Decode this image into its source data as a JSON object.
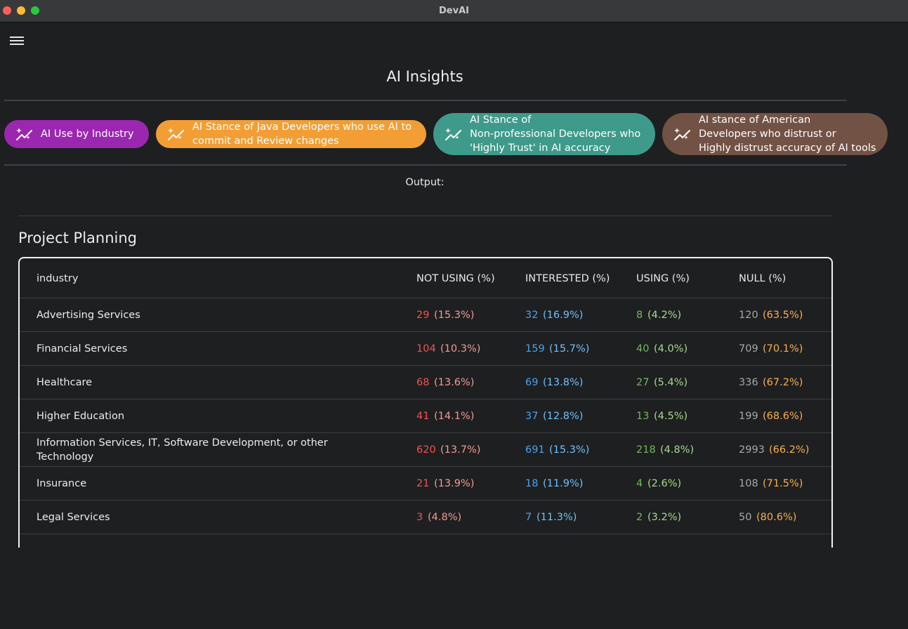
{
  "window": {
    "title": "DevAI"
  },
  "page": {
    "title": "AI Insights",
    "output_label": "Output:"
  },
  "chips": [
    {
      "label": "AI Use by Industry",
      "color": "#9b27b0",
      "icon": "sparkle-chart-icon"
    },
    {
      "label": "AI Stance of Java Developers who use AI to\n commit and Review changes",
      "color": "#f39e34",
      "icon": "sparkle-chart-icon"
    },
    {
      "label": "AI Stance of\nNon-professional Developers who\n'Highly Trust' in AI accuracy",
      "color": "#3e9a8a",
      "icon": "sparkle-chart-icon"
    },
    {
      "label": "AI stance of American\n Developers who distrust or\nHighly distrust accuracy of AI tools",
      "color": "#725245",
      "icon": "sparkle-chart-icon"
    }
  ],
  "section": {
    "title": "Project Planning"
  },
  "table": {
    "columns": [
      "industry",
      "NOT USING (%)",
      "INTERESTED (%)",
      "USING (%)",
      "NULL (%)"
    ],
    "rows": [
      {
        "industry": "Advertising Services",
        "not_using": "29",
        "not_using_pct": "(15.3%)",
        "interested": "32",
        "interested_pct": "(16.9%)",
        "using": "8",
        "using_pct": "(4.2%)",
        "null": "120",
        "null_pct": "(63.5%)"
      },
      {
        "industry": "Financial Services",
        "not_using": "104",
        "not_using_pct": "(10.3%)",
        "interested": "159",
        "interested_pct": "(15.7%)",
        "using": "40",
        "using_pct": "(4.0%)",
        "null": "709",
        "null_pct": "(70.1%)"
      },
      {
        "industry": "Healthcare",
        "not_using": "68",
        "not_using_pct": "(13.6%)",
        "interested": "69",
        "interested_pct": "(13.8%)",
        "using": "27",
        "using_pct": "(5.4%)",
        "null": "336",
        "null_pct": "(67.2%)"
      },
      {
        "industry": "Higher Education",
        "not_using": "41",
        "not_using_pct": "(14.1%)",
        "interested": "37",
        "interested_pct": "(12.8%)",
        "using": "13",
        "using_pct": "(4.5%)",
        "null": "199",
        "null_pct": "(68.6%)"
      },
      {
        "industry": "Information Services, IT, Software Development, or other\nTechnology",
        "not_using": "620",
        "not_using_pct": "(13.7%)",
        "interested": "691",
        "interested_pct": "(15.3%)",
        "using": "218",
        "using_pct": "(4.8%)",
        "null": "2993",
        "null_pct": "(66.2%)"
      },
      {
        "industry": "Insurance",
        "not_using": "21",
        "not_using_pct": "(13.9%)",
        "interested": "18",
        "interested_pct": "(11.9%)",
        "using": "4",
        "using_pct": "(2.6%)",
        "null": "108",
        "null_pct": "(71.5%)"
      },
      {
        "industry": "Legal Services",
        "not_using": "3",
        "not_using_pct": "(4.8%)",
        "interested": "7",
        "interested_pct": "(11.3%)",
        "using": "2",
        "using_pct": "(3.2%)",
        "null": "50",
        "null_pct": "(80.6%)"
      }
    ]
  }
}
